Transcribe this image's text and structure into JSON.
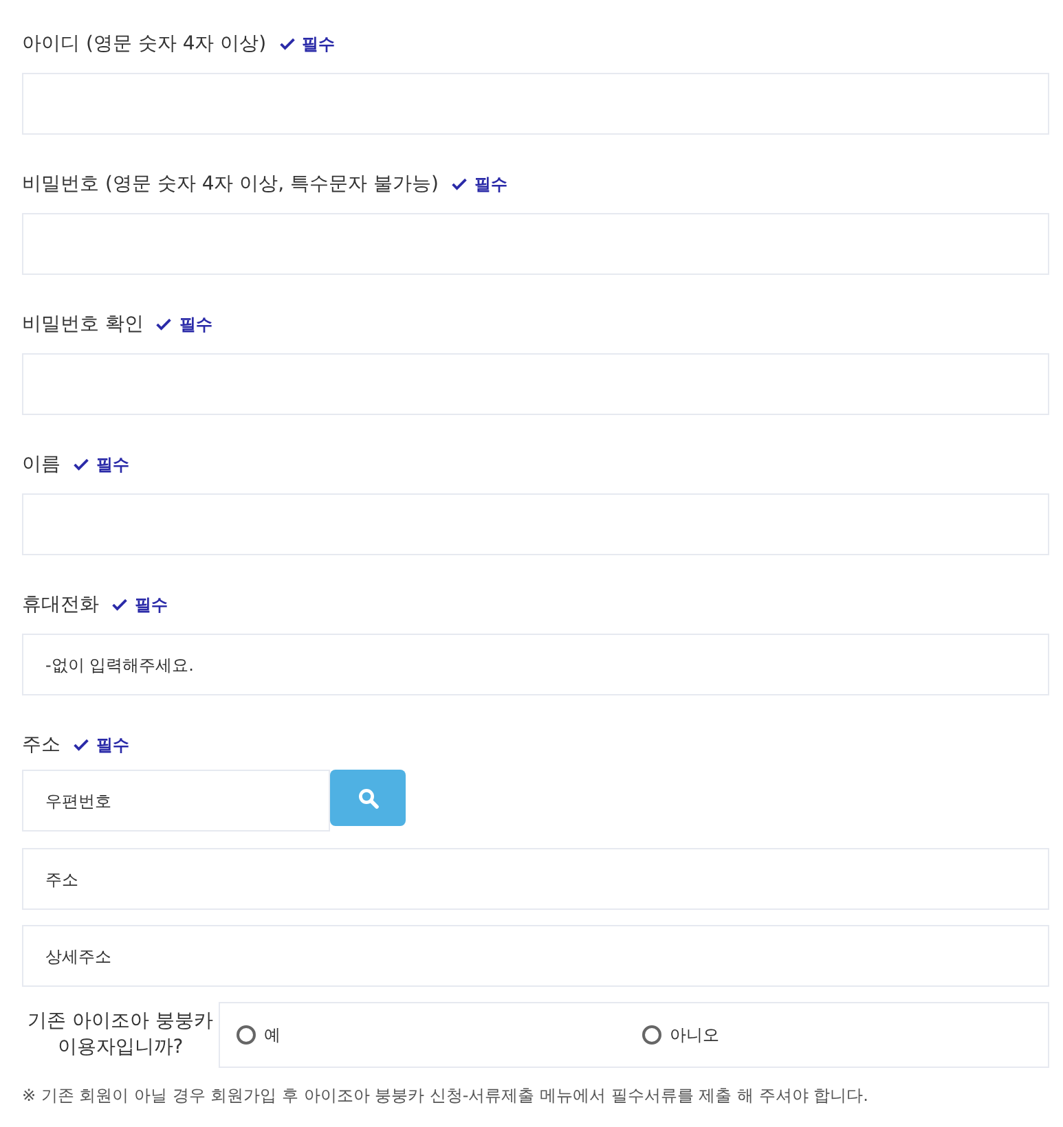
{
  "fields": [
    {
      "label": "아이디 (영문 숫자 4자 이상)",
      "required": true,
      "required_text": "필수"
    },
    {
      "label": "비밀번호 (영문 숫자 4자 이상, 특수문자 불가능)",
      "required": true,
      "required_text": "필수"
    },
    {
      "label": "비밀번호 확인",
      "required": true,
      "required_text": "필수"
    },
    {
      "label": "이름",
      "required": true,
      "required_text": "필수"
    },
    {
      "label": "휴대전화",
      "required": true,
      "required_text": "필수",
      "placeholder": "-없이 입력해주세요."
    }
  ],
  "address": {
    "label": "주소",
    "required": true,
    "required_text": "필수",
    "zip_placeholder": "우편번호",
    "address_placeholder": "주소",
    "detail_placeholder": "상세주소"
  },
  "existing_user": {
    "question": "기존 아이조아 붕붕카 이용자입니까?",
    "options": [
      {
        "label": "예",
        "selected": false
      },
      {
        "label": "아니오",
        "selected": false
      }
    ]
  },
  "note": "※ 기존 회원이 아닐 경우 회원가입 후 아이조아 붕붕카 신청-서류제출 메뉴에서 필수서류를 제출 해 주셔야 합니다."
}
